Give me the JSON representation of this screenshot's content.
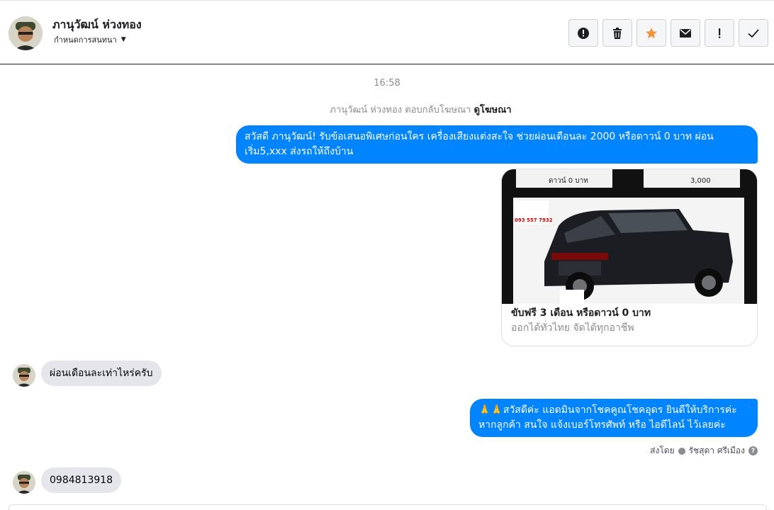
{
  "header": {
    "name": "ภานุวัฒน์ ห่วงทอง",
    "subtitle": "กำหนดการสนทนา"
  },
  "conversation": {
    "timestamp": "16:58",
    "ad_reply_text": "ภานุวัฒน์ ห่วงทอง ตอบกลับโฆษณา",
    "ad_link": "ดูโฆษณา",
    "msg_out_1": "สวัสดี ภานุวัฒน์! รับข้อเสนอพิเศษก่อนใคร เครื่องเสียงแต่งสะใจ ช่วยผ่อนเดือนละ 2000 หรือดาวน์ 0 บาท ผ่อนเริ่ม5,xxx ส่งรถให้ถึงบ้าน",
    "card": {
      "title": "ขับฟรี 3 เดือน หรือดาวน์ 0 บาท",
      "subtitle": "ออกได้ทั่วไทย จัดได้ทุกอาชีพ",
      "img_banner_left": "ดาวน์ 0 บาท",
      "img_banner_right": "3,000",
      "img_phone": "093 557 7932"
    },
    "msg_in_1": "ผ่อนเดือนละเท่าไหร่ครับ",
    "msg_out_2_emoji": "🙏🙏",
    "msg_out_2": "สวัสดีค่ะ แอดมินจากโชคคูณโชคอุดร ยินดีให้บริการค่ะ หากลูกค้า สนใจ แจ้งเบอร์โทรศัพท์ หรือ ไอดีไลน์  ไว้เลยค่ะ",
    "sent_by_label": "ส่งโดย",
    "sent_by_name": "รัชสุดา ศรีเมือง",
    "msg_in_2": "0984813918"
  },
  "colors": {
    "accent": "#0084ff",
    "incoming": "#e4e6eb",
    "star": "#f7923b"
  },
  "icons": [
    "alert-circle-icon",
    "trash-icon",
    "star-icon",
    "envelope-icon",
    "exclamation-icon",
    "check-icon"
  ]
}
